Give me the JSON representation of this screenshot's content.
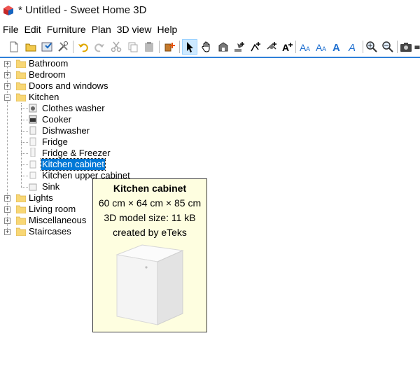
{
  "window": {
    "title": "* Untitled - Sweet Home 3D"
  },
  "menu": [
    "File",
    "Edit",
    "Furniture",
    "Plan",
    "3D view",
    "Help"
  ],
  "toolbar": {
    "buttons": [
      {
        "name": "new-icon"
      },
      {
        "name": "open-icon"
      },
      {
        "name": "save-icon"
      },
      {
        "name": "preferences-icon"
      },
      {
        "name": "undo-icon"
      },
      {
        "name": "redo-icon"
      },
      {
        "name": "cut-icon"
      },
      {
        "name": "copy-icon"
      },
      {
        "name": "paste-icon"
      },
      {
        "name": "add-furniture-icon"
      },
      {
        "name": "select-mode-icon"
      },
      {
        "name": "pan-mode-icon"
      },
      {
        "name": "create-rooms-icon"
      },
      {
        "name": "create-walls-icon"
      },
      {
        "name": "create-polylines-icon"
      },
      {
        "name": "create-dimensions-icon"
      },
      {
        "name": "add-text-icon"
      },
      {
        "name": "text-style-icon-1"
      },
      {
        "name": "text-style-icon-2"
      },
      {
        "name": "text-style-bold-icon"
      },
      {
        "name": "text-style-italic-icon"
      },
      {
        "name": "zoom-in-icon"
      },
      {
        "name": "zoom-out-icon"
      },
      {
        "name": "create-photo-icon"
      },
      {
        "name": "create-video-icon"
      }
    ]
  },
  "tree": {
    "categories": [
      {
        "label": "Bathroom",
        "expanded": false
      },
      {
        "label": "Bedroom",
        "expanded": false
      },
      {
        "label": "Doors and windows",
        "expanded": false
      },
      {
        "label": "Kitchen",
        "expanded": true
      },
      {
        "label": "Lights",
        "expanded": false
      },
      {
        "label": "Living room",
        "expanded": false
      },
      {
        "label": "Miscellaneous",
        "expanded": false
      },
      {
        "label": "Staircases",
        "expanded": false
      }
    ],
    "kitchen_items": [
      {
        "label": "Clothes washer"
      },
      {
        "label": "Cooker"
      },
      {
        "label": "Dishwasher"
      },
      {
        "label": "Fridge"
      },
      {
        "label": "Fridge & Freezer"
      },
      {
        "label": "Kitchen cabinet",
        "selected": true
      },
      {
        "label": "Kitchen upper cabinet"
      },
      {
        "label": "Sink"
      }
    ]
  },
  "tooltip": {
    "name": "Kitchen cabinet",
    "dimensions": "60 cm × 64 cm × 85 cm",
    "model_size": "3D model size: 11 kB",
    "creator": "created by eTeks"
  },
  "colors": {
    "selection": "#0078d7",
    "tooltip_bg": "#fefee0",
    "folder": "#f8d775",
    "border_accent": "#2f80d8"
  }
}
